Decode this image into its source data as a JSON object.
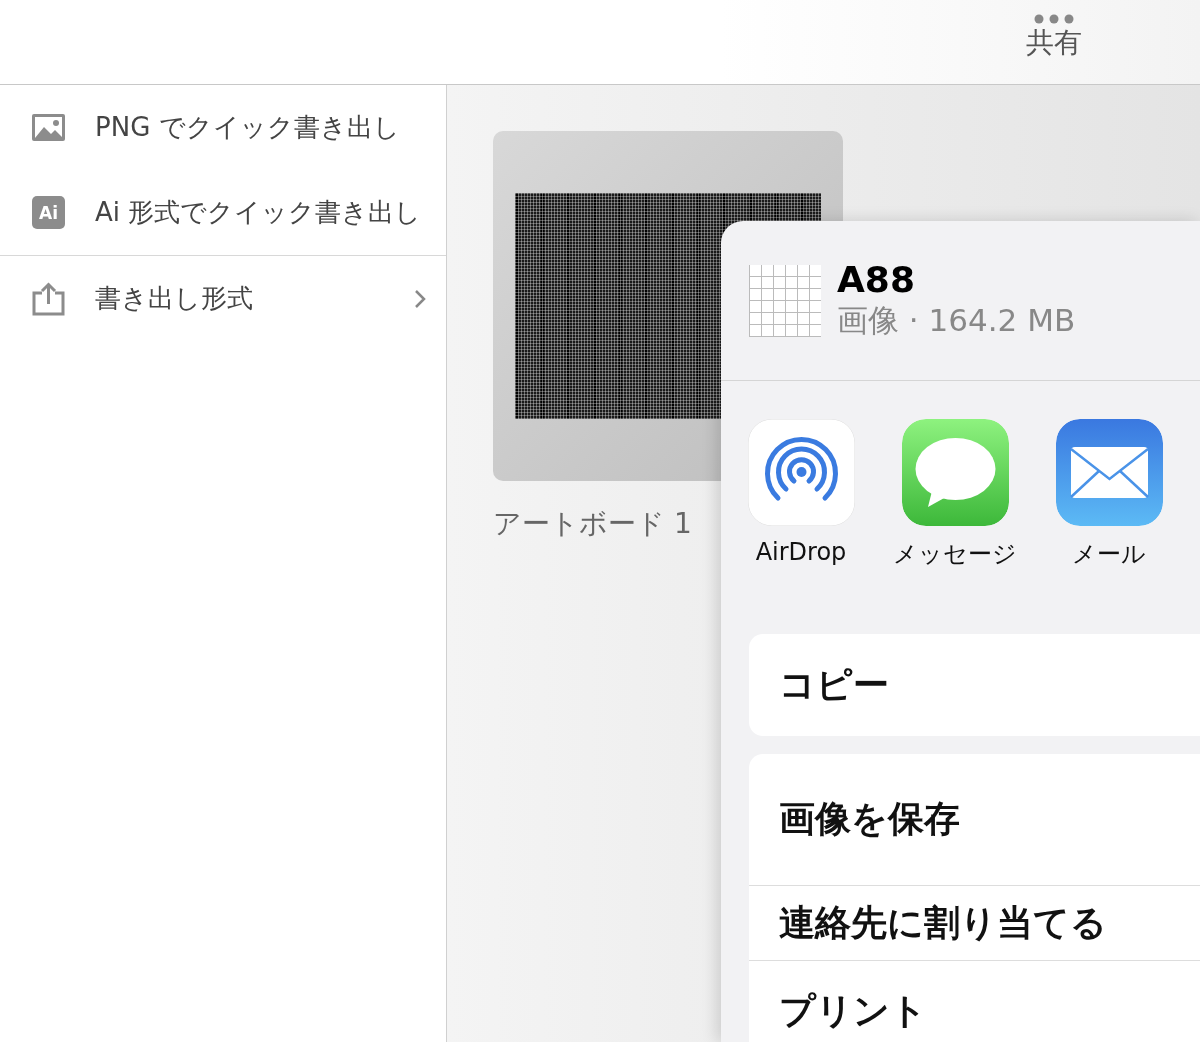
{
  "top_bar": {
    "share_button": "共有"
  },
  "menu": {
    "groups": [
      [
        {
          "kind": "image",
          "label": "PNG でクイック書き出し",
          "has_submenu": false
        },
        {
          "kind": "ai",
          "label": "Ai 形式でクイック書き出し",
          "icon_text": "Ai",
          "has_submenu": false
        }
      ],
      [
        {
          "kind": "export",
          "label": "書き出し形式",
          "has_submenu": true
        }
      ]
    ]
  },
  "artboards": [
    {
      "label": "アートボード 1"
    }
  ],
  "share_sheet": {
    "title": "A88",
    "subtitle": "画像 · 164.2 MB",
    "apps": [
      {
        "kind": "airdrop",
        "label": "AirDrop"
      },
      {
        "kind": "messages",
        "label": "メッセージ"
      },
      {
        "kind": "mail",
        "label": "メール"
      }
    ],
    "action_groups": [
      [
        "コピー"
      ],
      [
        "画像を保存",
        "連絡先に割り当てる",
        "プリント"
      ]
    ]
  }
}
